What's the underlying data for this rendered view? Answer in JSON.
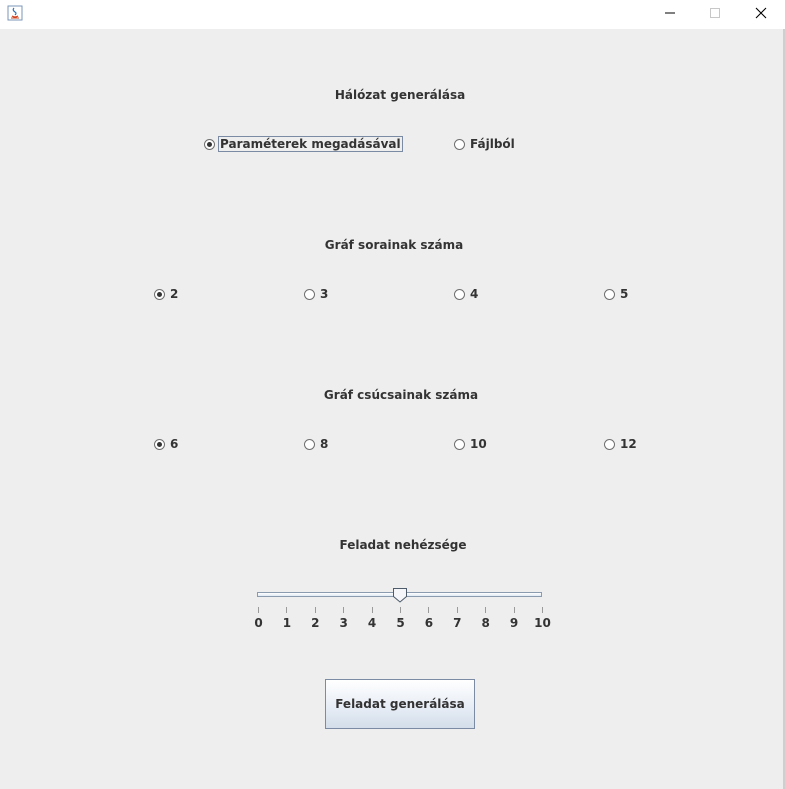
{
  "window": {
    "icon": "java-icon",
    "minimize_icon": "minimize-icon",
    "maximize_icon": "maximize-icon",
    "close_icon": "close-icon"
  },
  "network_section": {
    "title": "Hálózat generálása",
    "options": [
      {
        "label": "Paraméterek megadásával",
        "checked": true
      },
      {
        "label": "Fájlból",
        "checked": false
      }
    ]
  },
  "rows_section": {
    "title": "Gráf sorainak száma",
    "options": [
      {
        "label": "2",
        "checked": true
      },
      {
        "label": "3",
        "checked": false
      },
      {
        "label": "4",
        "checked": false
      },
      {
        "label": "5",
        "checked": false
      }
    ]
  },
  "vertices_section": {
    "title": "Gráf csúcsainak száma",
    "options": [
      {
        "label": "6",
        "checked": true
      },
      {
        "label": "8",
        "checked": false
      },
      {
        "label": "10",
        "checked": false
      },
      {
        "label": "12",
        "checked": false
      }
    ]
  },
  "difficulty_section": {
    "title": "Feladat nehézsége",
    "slider": {
      "min": 0,
      "max": 10,
      "value": 5,
      "tick_labels": [
        "0",
        "1",
        "2",
        "3",
        "4",
        "5",
        "6",
        "7",
        "8",
        "9",
        "10"
      ]
    }
  },
  "generate_button": {
    "label": "Feladat generálása"
  }
}
